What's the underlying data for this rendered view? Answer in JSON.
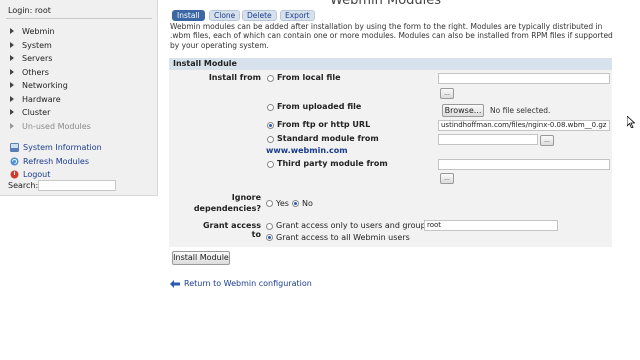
{
  "app": {
    "title": "Webmin Modules"
  },
  "sidebar": {
    "login": "Login: root",
    "categories": [
      {
        "label": "Webmin"
      },
      {
        "label": "System"
      },
      {
        "label": "Servers"
      },
      {
        "label": "Others"
      },
      {
        "label": "Networking"
      },
      {
        "label": "Hardware"
      },
      {
        "label": "Cluster"
      },
      {
        "label": "Un-used Modules"
      }
    ],
    "system_links": [
      {
        "label": "System Information",
        "icon": "info-icon"
      },
      {
        "label": "Refresh Modules",
        "icon": "refresh-icon"
      },
      {
        "label": "Logout",
        "icon": "logout-icon"
      }
    ],
    "search_label": "Search:"
  },
  "tabs": [
    {
      "label": "Install",
      "active": true
    },
    {
      "label": "Clone",
      "active": false
    },
    {
      "label": "Delete",
      "active": false
    },
    {
      "label": "Export",
      "active": false
    }
  ],
  "intro": "Webmin modules can be added after installation by using the form to the right. Modules are typically distributed in .wbm files, each of which can contain one or more modules. Modules can also be installed from RPM files if supported by your operating system.",
  "panel": {
    "title": "Install Module",
    "install_from_label": "Install from",
    "sources": [
      {
        "label": "From local file",
        "selected": false
      },
      {
        "label": "From uploaded file",
        "selected": false
      },
      {
        "label": "From ftp or http URL",
        "selected": true
      },
      {
        "label": "Standard module from",
        "link": "www.webmin.com",
        "selected": false
      },
      {
        "label": "Third party module from",
        "selected": false
      }
    ],
    "browse_label": "Browse...",
    "no_file": "No file selected.",
    "url_value": "ustindhoffman.com/files/nginx-0.08.wbm__0.gz",
    "ellipsis": "...",
    "ignore_label_1": "Ignore",
    "ignore_label_2": "dependencies?",
    "ignore_yes": "Yes",
    "ignore_no": "No",
    "ignore_selected": "No",
    "grant_label": "Grant access to",
    "grant_option_1": "Grant access only to users and groups :",
    "grant_option_1_value": "root",
    "grant_option_2": "Grant access to all Webmin users",
    "grant_selected": 2
  },
  "install_button": "Install Module",
  "return_link": "Return to Webmin configuration",
  "colors": {
    "accent": "#3b68a4",
    "link": "#1a3c8e",
    "panel_bg": "#f2f2f2",
    "panel_head": "#d8e2ec"
  }
}
